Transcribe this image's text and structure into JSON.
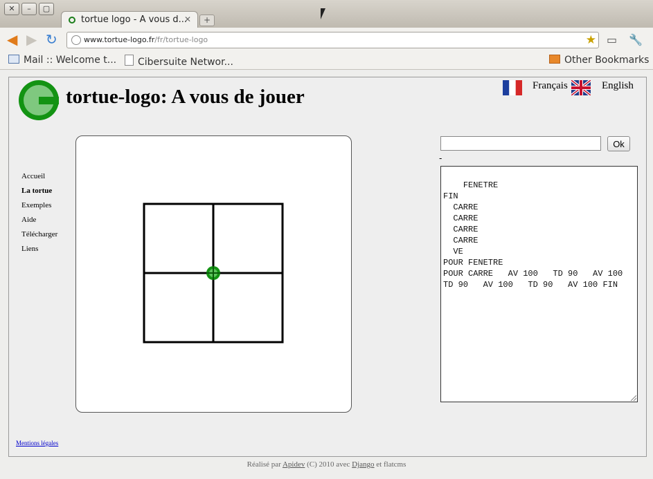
{
  "browser": {
    "tab_title": "tortue logo - A vous d...",
    "url_domain": "www.tortue-logo.fr",
    "url_path": "/fr/tortue-logo",
    "bookmarks": [
      "Mail :: Welcome t...",
      "Cibersuite Networ..."
    ],
    "other_bookmarks": "Other Bookmarks"
  },
  "header": {
    "title": "tortue-logo: A vous de jouer",
    "lang_fr": "Français",
    "lang_en": "English"
  },
  "nav": {
    "items": [
      "Accueil",
      "La tortue",
      "Exemples",
      "Aide",
      "Télécharger",
      "Liens"
    ],
    "active": "La tortue"
  },
  "command": {
    "input_value": "",
    "ok_label": "Ok",
    "status": "-",
    "program": "FENETRE\nFIN\n  CARRE\n  CARRE\n  CARRE\n  CARRE\n  VE\nPOUR FENETRE\nPOUR CARRE   AV 100   TD 90   AV 100   TD 90   AV 100   TD 90   AV 100 FIN"
  },
  "footer": {
    "legal": "Mentions légales",
    "prefix": "Réalisé par",
    "apidev": "Apidev",
    "middle": "(C) 2010 avec",
    "django": "Django",
    "suffix": "et flatcms"
  },
  "colors": {
    "turtle_green": "#139313",
    "link": "#0000cc"
  }
}
